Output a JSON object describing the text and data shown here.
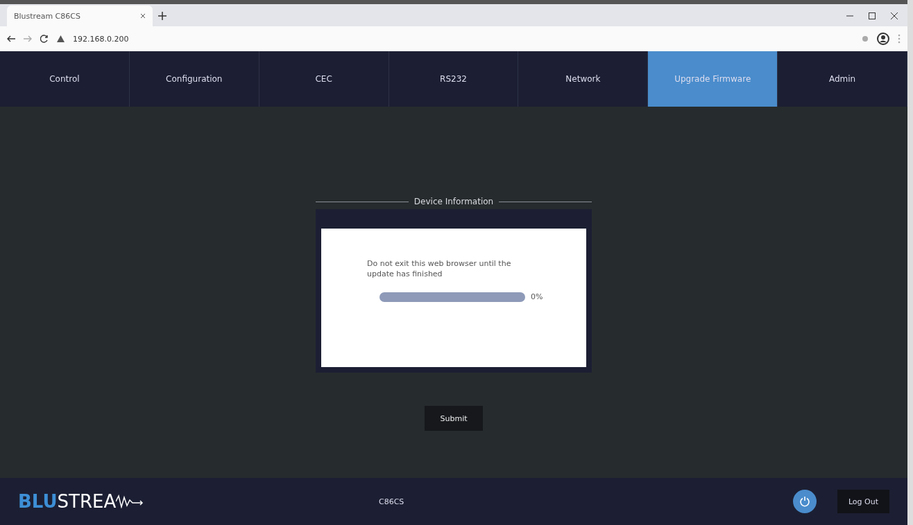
{
  "browser": {
    "tab_title": "Blustream C86CS",
    "url": "192.168.0.200"
  },
  "nav": {
    "tabs": [
      {
        "label": "Control",
        "selected": false
      },
      {
        "label": "Configuration",
        "selected": false
      },
      {
        "label": "CEC",
        "selected": false
      },
      {
        "label": "RS232",
        "selected": false
      },
      {
        "label": "Network",
        "selected": false
      },
      {
        "label": "Upgrade Firmware",
        "selected": true
      },
      {
        "label": "Admin",
        "selected": false
      }
    ]
  },
  "panel": {
    "legend": "Device Information",
    "message": "Do not exit this web browser until the update has finished",
    "progress": {
      "level": 0,
      "reading": "0%"
    },
    "submit": "Submit"
  },
  "footer": {
    "logo_blue": "BLU",
    "logo_white": "STREA",
    "model": "C86CS",
    "logout": "Log Out"
  }
}
